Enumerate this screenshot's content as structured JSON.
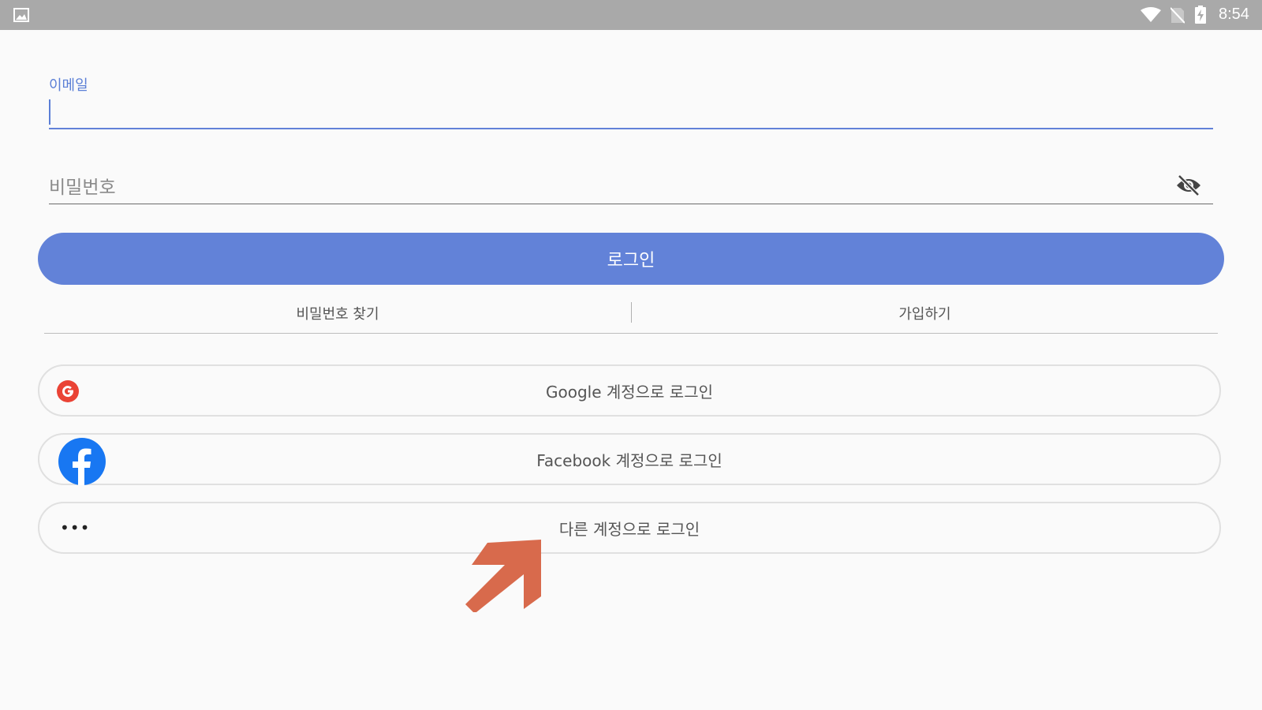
{
  "statusbar": {
    "time": "8:54",
    "icons": [
      "gallery-icon",
      "wifi-icon",
      "no-sim-icon",
      "battery-charging-icon"
    ]
  },
  "login_form": {
    "email_label": "이메일",
    "email_value": "",
    "password_placeholder": "비밀번호",
    "password_value": "",
    "visibility_icon": "eye-off-icon",
    "login_label": "로그인"
  },
  "links": {
    "find_password": "비밀번호 찾기",
    "signup": "가입하기"
  },
  "social": {
    "google_label": "Google 계정으로 로그인",
    "facebook_label": "Facebook 계정으로 로그인",
    "other_label": "다른 계정으로 로그인",
    "more_glyph": "•••"
  },
  "colors": {
    "accent": "#6282d8",
    "statusbar": "#a9a9a9",
    "annotation_arrow": "#d86a4c",
    "google_red": "#ea4335",
    "facebook_blue": "#1877f2"
  }
}
